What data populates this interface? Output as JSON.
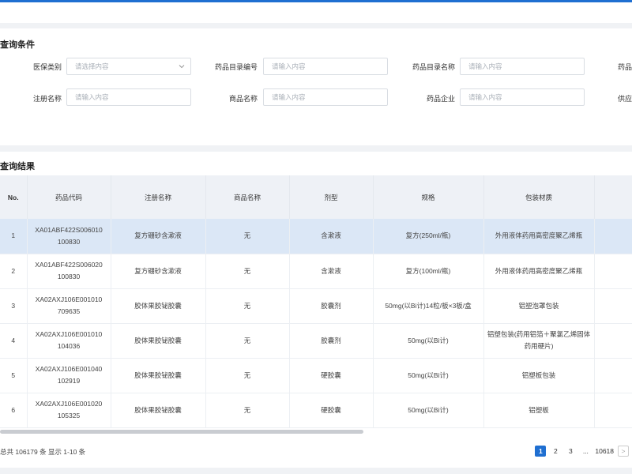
{
  "conditions": {
    "title": "查询条件",
    "fields": [
      {
        "label": "医保类别",
        "placeholder": "请选择内容",
        "type": "select"
      },
      {
        "label": "药品目录编号",
        "placeholder": "请输入内容",
        "type": "input"
      },
      {
        "label": "药品目录名称",
        "placeholder": "请输入内容",
        "type": "input"
      },
      {
        "label": "药品",
        "placeholder": "",
        "type": "partial"
      },
      {
        "label": "注册名称",
        "placeholder": "请输入内容",
        "type": "input"
      },
      {
        "label": "商品名称",
        "placeholder": "请输入内容",
        "type": "input"
      },
      {
        "label": "药品企业",
        "placeholder": "请输入内容",
        "type": "input"
      },
      {
        "label": "供应",
        "placeholder": "",
        "type": "partial"
      }
    ]
  },
  "results": {
    "title": "查询结果",
    "columns": [
      "No.",
      "药品代码",
      "注册名称",
      "商品名称",
      "剂型",
      "规格",
      "包装材质"
    ],
    "rows": [
      {
        "no": "1",
        "code": "XA01ABF422S006010100830",
        "reg_name": "复方硼砂含漱液",
        "trade_name": "无",
        "dosage": "含漱液",
        "spec": "复方(250ml/瓶)",
        "pack": "外用液体药用高密度聚乙烯瓶"
      },
      {
        "no": "2",
        "code": "XA01ABF422S006020100830",
        "reg_name": "复方硼砂含漱液",
        "trade_name": "无",
        "dosage": "含漱液",
        "spec": "复方(100ml/瓶)",
        "pack": "外用液体药用高密度聚乙烯瓶"
      },
      {
        "no": "3",
        "code": "XA02AXJ106E001010709635",
        "reg_name": "胶体果胶铋胶囊",
        "trade_name": "无",
        "dosage": "胶囊剂",
        "spec": "50mg(以Bi计)14粒/板×3板/盒",
        "pack": "铝塑泡罩包装"
      },
      {
        "no": "4",
        "code": "XA02AXJ106E001010104036",
        "reg_name": "胶体果胶铋胶囊",
        "trade_name": "无",
        "dosage": "胶囊剂",
        "spec": "50mg(以Bi计)",
        "pack": "铝塑包装(药用铝箔＋聚氯乙烯固体药用硬片)"
      },
      {
        "no": "5",
        "code": "XA02AXJ106E001040102919",
        "reg_name": "胶体果胶铋胶囊",
        "trade_name": "无",
        "dosage": "硬胶囊",
        "spec": "50mg(以Bi计)",
        "pack": "铝塑板包装"
      },
      {
        "no": "6",
        "code": "XA02AXJ106E001020105325",
        "reg_name": "胶体果胶铋胶囊",
        "trade_name": "无",
        "dosage": "硬胶囊",
        "spec": "50mg(以Bi计)",
        "pack": "铝塑板"
      }
    ]
  },
  "footer": {
    "total_text": "总共 106179 条 显示 1-10 条",
    "pages": [
      "1",
      "2",
      "3",
      "...",
      "10618"
    ],
    "active_page": "1",
    "next_label": ">"
  },
  "colors": {
    "accent": "#1f6fd1",
    "header_bg": "#eef1f6",
    "selected_row": "#dbe7f6"
  }
}
